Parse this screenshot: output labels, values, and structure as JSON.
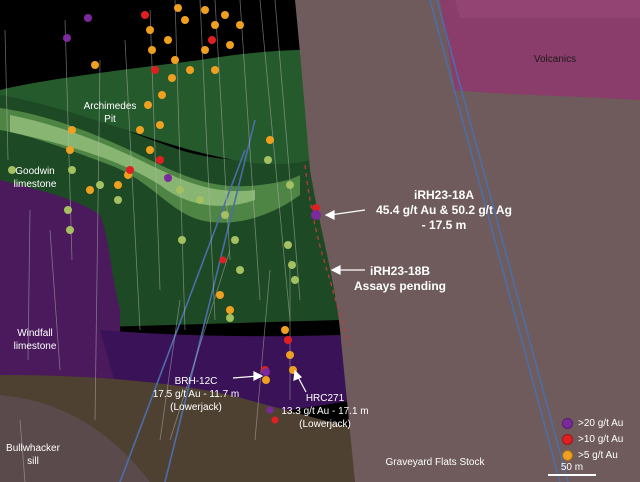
{
  "colors": {
    "background": "#000000",
    "goodwin_green": "#1d4a24",
    "pit_light_green": "#88b572",
    "windfall_purple": "#4a1a5c",
    "lowerjack_purple": "#3a1257",
    "graveyard_flats": "#6f5b5b",
    "volcanics": "#8a3c6a",
    "bullwhacker": "#5a4a4c",
    "sill_brown": "#4f4131",
    "grade_20": "#7a2a9c",
    "grade_10": "#e02020",
    "grade_5": "#f0a020"
  },
  "map_labels": {
    "archimedes_pit": "Archimedes\nPit",
    "goodwin_limestone": "Goodwin\nlimestone",
    "windfall_limestone": "Windfall\nlimestone",
    "bullwhacker_sill": "Bullwhacker\nsill",
    "volcanics": "Volcanics",
    "graveyard_flats_stock": "Graveyard Flats Stock"
  },
  "callouts": {
    "irh23_18a": "iRH23-18A\n45.4 g/t Au & 50.2 g/t Ag\n- 17.5 m",
    "irh23_18b": "iRH23-18B\nAssays pending",
    "brh_12c": "BRH-12C\n17.5 g/t Au - 11.7 m\n(Lowerjack)",
    "hrc271": "HRC271\n13.3 g/t Au - 17.1 m\n(Lowerjack)"
  },
  "legend": {
    "items": [
      {
        "label": ">20 g/t Au",
        "color": "#7a2a9c"
      },
      {
        "label": ">10 g/t Au",
        "color": "#e02020"
      },
      {
        "label": ">5 g/t Au",
        "color": "#f0a020"
      }
    ]
  },
  "scale": {
    "label": "50 m"
  }
}
